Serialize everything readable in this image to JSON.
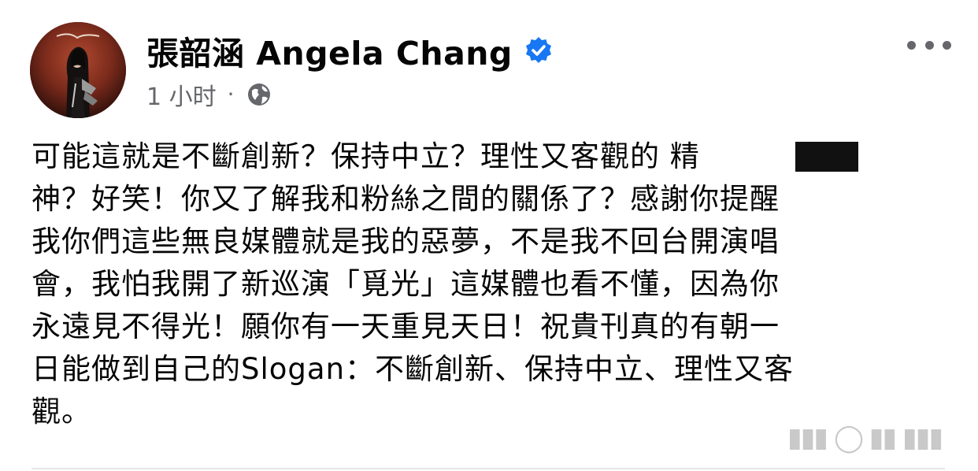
{
  "post": {
    "author_name": "張韶涵 Angela Chang",
    "verified_icon": "verified-badge-icon",
    "verified_color": "#1877f2",
    "timestamp": "1 小时",
    "separator": "·",
    "audience_icon": "globe-icon",
    "more_icon": "more-horizontal-icon",
    "body": "可能這就是不斷創新？保持中立？理性又客觀的    精\n神？好笑！你又了解我和粉絲之間的關係了？感謝你提醒\n我你們這些無良媒體就是我的惡夢，不是我不回台開演唱\n會，我怕我開了新巡演「覓光」這媒體也看不懂，因為你\n永遠見不得光！願你有一天重見天日！祝貴刊真的有朝一\n日能做到自己的Slogan：不斷創新、保持中立、理性又客\n觀。"
  },
  "colors": {
    "text_primary": "#050505",
    "text_secondary": "#65676b",
    "background": "#ffffff",
    "redaction": "#111111"
  }
}
